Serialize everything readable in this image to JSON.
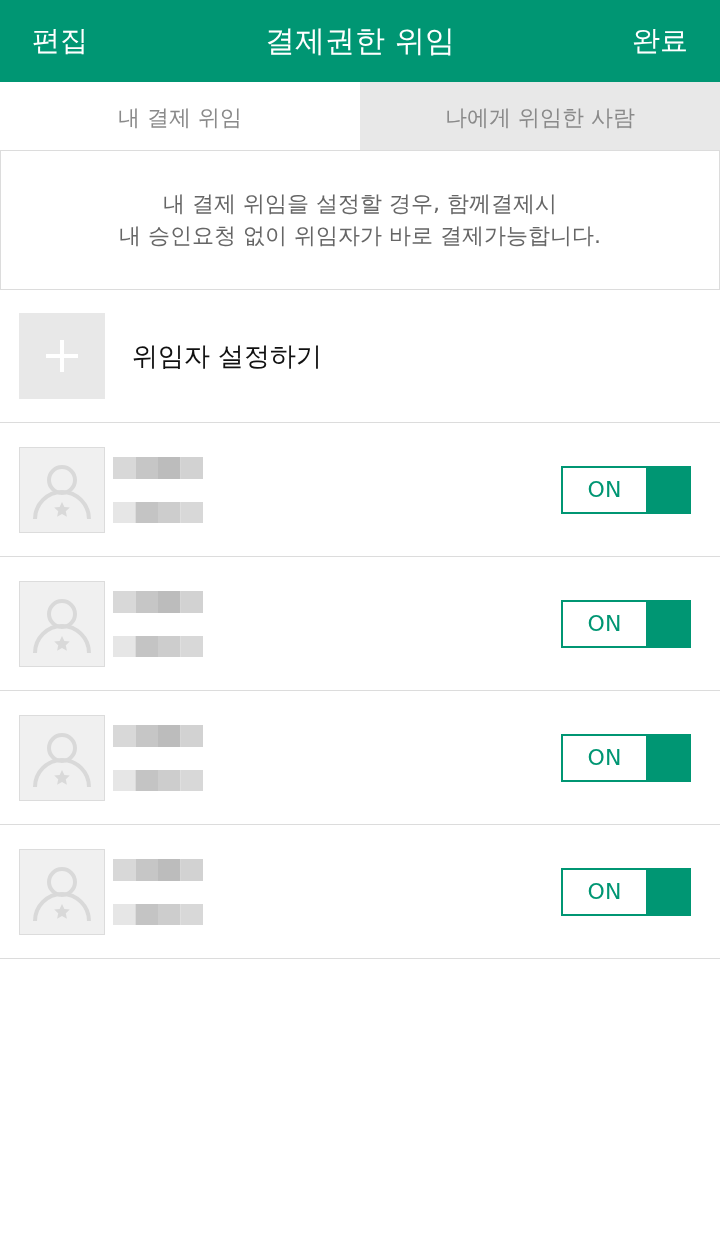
{
  "header": {
    "left_action": "편집",
    "title": "결제권한 위임",
    "right_action": "완료"
  },
  "tabs": [
    {
      "label": "내 결제 위임",
      "selected": true
    },
    {
      "label": "나에게 위임한 사람",
      "selected": false
    }
  ],
  "notice": {
    "text": "내 결제 위임을 설정할 경우, 함께결제시\n내 승인요청 없이 위임자가 바로 결제가능합니다."
  },
  "add_delegate": {
    "label": "위임자 설정하기"
  },
  "delegates": [
    {
      "toggle_label": "ON",
      "on": true
    },
    {
      "toggle_label": "ON",
      "on": true
    },
    {
      "toggle_label": "ON",
      "on": true
    },
    {
      "toggle_label": "ON",
      "on": true
    }
  ]
}
